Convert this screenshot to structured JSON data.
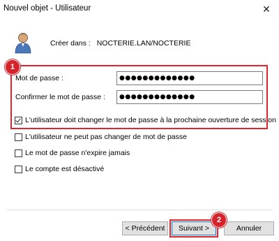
{
  "window": {
    "title": "Nouvel objet - Utilisateur"
  },
  "header": {
    "create_in_label": "Créer dans :",
    "create_in_value": "NOCTERIE.LAN/NOCTERIE"
  },
  "form": {
    "password_label": "Mot de passe :",
    "password_value": "●●●●●●●●●●●●●",
    "confirm_label": "Confirmer le mot de passe :",
    "confirm_value": "●●●●●●●●●●●●●"
  },
  "options": [
    {
      "label": "L'utilisateur doit changer le mot de passe à la prochaine ouverture de session",
      "checked": true
    },
    {
      "label": "L'utilisateur ne peut pas changer de mot de passe",
      "checked": false
    },
    {
      "label": "Le mot de passe n'expire jamais",
      "checked": false
    },
    {
      "label": "Le compte est désactivé",
      "checked": false
    }
  ],
  "buttons": {
    "previous": "< Précédent",
    "next": "Suivant >",
    "cancel": "Annuler"
  },
  "annotations": {
    "step1": "1",
    "step2": "2"
  },
  "colors": {
    "highlight": "#e2232b",
    "badge": "#d6232b"
  }
}
